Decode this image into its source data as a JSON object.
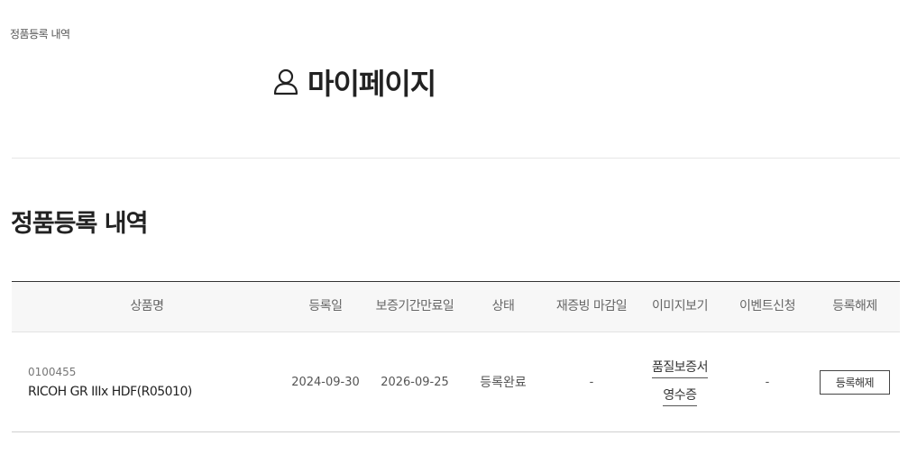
{
  "breadcrumb": {
    "current": "정품등록 내역"
  },
  "header": {
    "title": "마이페이지",
    "icon": "user-icon"
  },
  "section": {
    "title": "정품등록 내역"
  },
  "table": {
    "columns": {
      "product": "상품명",
      "reg_date": "등록일",
      "warranty_end": "보증기간만료일",
      "status": "상태",
      "resubmit_deadline": "재증빙 마감일",
      "image_view": "이미지보기",
      "event_apply": "이벤트신청",
      "unregister": "등록해제"
    },
    "rows": [
      {
        "product_code": "0100455",
        "product_name": "RICOH GR IIIx HDF(R05010)",
        "reg_date": "2024-09-30",
        "warranty_end": "2026-09-25",
        "status": "등록완료",
        "resubmit_deadline": "-",
        "image_links": {
          "warranty_card": "품질보증서",
          "receipt": "영수증"
        },
        "event_apply": "-",
        "unregister_label": "등록해제"
      }
    ]
  }
}
